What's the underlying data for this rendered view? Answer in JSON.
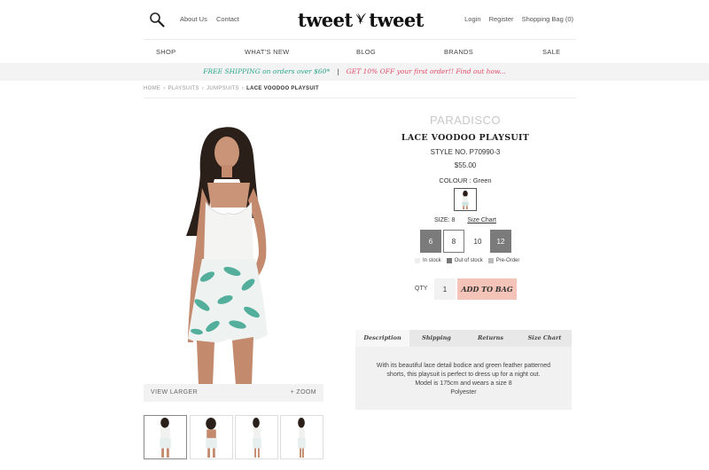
{
  "header": {
    "top_links": [
      "About Us",
      "Contact"
    ],
    "logo_left": "tweet",
    "logo_right": "tweet",
    "account_links": [
      "Login",
      "Register",
      "Shopping Bag (0)"
    ]
  },
  "nav": {
    "items": [
      "SHOP",
      "WHAT'S NEW",
      "BLOG",
      "BRANDS",
      "SALE"
    ]
  },
  "promo": {
    "free_shipping": "FREE SHIPPING on orders over $60*",
    "separator": "|",
    "discount": "GET 10% OFF your first order!! Find out how..."
  },
  "breadcrumb": {
    "items": [
      "HOME",
      "PLAYSUITS",
      "JUMPSUITS"
    ],
    "current": "LACE VOODOO PLAYSUIT"
  },
  "gallery": {
    "view_larger": "VIEW LARGER",
    "zoom": "+ ZOOM"
  },
  "product": {
    "brand": "PARADISCO",
    "name": "LACE VOODOO PLAYSUIT",
    "style_no": "STYLE NO. P70990-3",
    "price": "$55.00",
    "colour": "COLOUR : Green",
    "size_label": "SIZE: 8",
    "size_chart": "Size Chart",
    "sizes": [
      "6",
      "8",
      "10",
      "12"
    ],
    "legend": [
      "In stock",
      "Out of stock",
      "Pre-Order"
    ],
    "qty_label": "QTY",
    "qty_value": "1",
    "add_to_bag": "ADD TO BAG"
  },
  "tabs": {
    "items": [
      "Description",
      "Shipping",
      "Returns",
      "Size Chart"
    ],
    "description_lines": [
      "With its beautiful lace detail bodice and green feather patterned",
      "shorts, this playsuit is perfect to dress up for a night out.",
      "Model is 175cm and wears a size 8",
      "Polyester"
    ]
  },
  "colors": {
    "accent_green": "#2aa58a",
    "accent_pink": "#e24b67",
    "add_to_bag_bg": "#f5c4b8",
    "size_out_of_stock": "#7b7b7b"
  }
}
